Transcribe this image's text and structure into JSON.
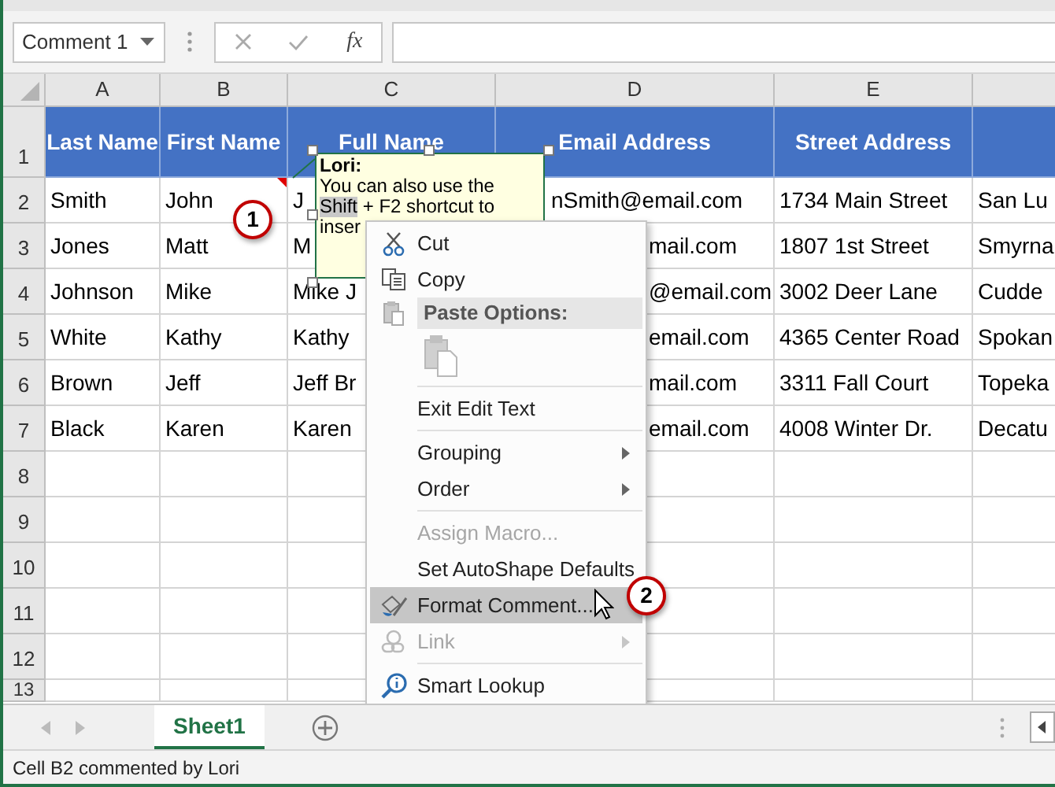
{
  "name_box": {
    "value": "Comment 1"
  },
  "formula_bar": {
    "function_label": "fx"
  },
  "columns": [
    "A",
    "B",
    "C",
    "D",
    "E"
  ],
  "header_row": {
    "number": "1",
    "cells": [
      "Last Name",
      "First Name",
      "Full Name",
      "Email Address",
      "Street Address"
    ]
  },
  "rows": [
    {
      "number": "2",
      "cells": [
        "Smith",
        "John",
        "J",
        "nSmith@email.com",
        "1734 Main Street",
        "San Lu"
      ],
      "has_comment": true
    },
    {
      "number": "3",
      "cells": [
        "Jones",
        "Matt",
        "M",
        "mail.com",
        "1807 1st Street",
        "Smyrna"
      ],
      "has_comment": false
    },
    {
      "number": "4",
      "cells": [
        "Johnson",
        "Mike",
        "Mike J",
        "@email.com",
        "3002 Deer Lane",
        "Cudde"
      ],
      "has_comment": false
    },
    {
      "number": "5",
      "cells": [
        "White",
        "Kathy",
        "Kathy",
        "email.com",
        "4365 Center Road",
        "Spokan"
      ],
      "has_comment": false
    },
    {
      "number": "6",
      "cells": [
        "Brown",
        "Jeff",
        "Jeff Br",
        "mail.com",
        "3311 Fall Court",
        "Topeka"
      ],
      "has_comment": false
    },
    {
      "number": "7",
      "cells": [
        "Black",
        "Karen",
        "Karen",
        "email.com",
        "4008 Winter Dr.",
        "Decatu"
      ],
      "has_comment": false
    },
    {
      "number": "8",
      "cells": [],
      "has_comment": false
    },
    {
      "number": "9",
      "cells": [],
      "has_comment": false
    },
    {
      "number": "10",
      "cells": [],
      "has_comment": false
    },
    {
      "number": "11",
      "cells": [],
      "has_comment": false
    },
    {
      "number": "12",
      "cells": [],
      "has_comment": false
    },
    {
      "number": "13",
      "cells": [],
      "has_comment": false
    }
  ],
  "comment": {
    "author": "Lori:",
    "lines": [
      {
        "text": "You can also use the"
      },
      {
        "selected_text": "Shift",
        "text": " + F2 shortcut to"
      },
      {
        "text": "inser"
      }
    ]
  },
  "callouts": [
    "1",
    "2"
  ],
  "context_menu": {
    "items": [
      {
        "kind": "item",
        "label": "Cut",
        "disabled": false,
        "selected": false,
        "has_submenu": false
      },
      {
        "kind": "item",
        "label": "Copy",
        "disabled": false,
        "selected": false,
        "has_submenu": false
      },
      {
        "kind": "header",
        "label": "Paste Options:"
      },
      {
        "kind": "paste-icons"
      },
      {
        "kind": "separator"
      },
      {
        "kind": "item",
        "label": "Exit Edit Text",
        "disabled": false,
        "selected": false,
        "has_submenu": false
      },
      {
        "kind": "separator"
      },
      {
        "kind": "item",
        "label": "Grouping",
        "disabled": false,
        "selected": false,
        "has_submenu": true
      },
      {
        "kind": "item",
        "label": "Order",
        "disabled": false,
        "selected": false,
        "has_submenu": true
      },
      {
        "kind": "separator"
      },
      {
        "kind": "item",
        "label": "Assign Macro...",
        "disabled": true,
        "selected": false,
        "has_submenu": false
      },
      {
        "kind": "item",
        "label": "Set AutoShape Defaults",
        "disabled": false,
        "selected": false,
        "has_submenu": false
      },
      {
        "kind": "item",
        "label": "Format Comment...",
        "disabled": false,
        "selected": true,
        "has_submenu": false
      },
      {
        "kind": "item",
        "label": "Link",
        "disabled": true,
        "selected": false,
        "has_submenu": true
      },
      {
        "kind": "separator"
      },
      {
        "kind": "item",
        "label": "Smart Lookup",
        "disabled": false,
        "selected": false,
        "has_submenu": false
      }
    ]
  },
  "sheet_tabs": [
    {
      "label": "Sheet1",
      "selected": true
    }
  ],
  "status_bar": {
    "text": "Cell B2 commented by Lori"
  }
}
